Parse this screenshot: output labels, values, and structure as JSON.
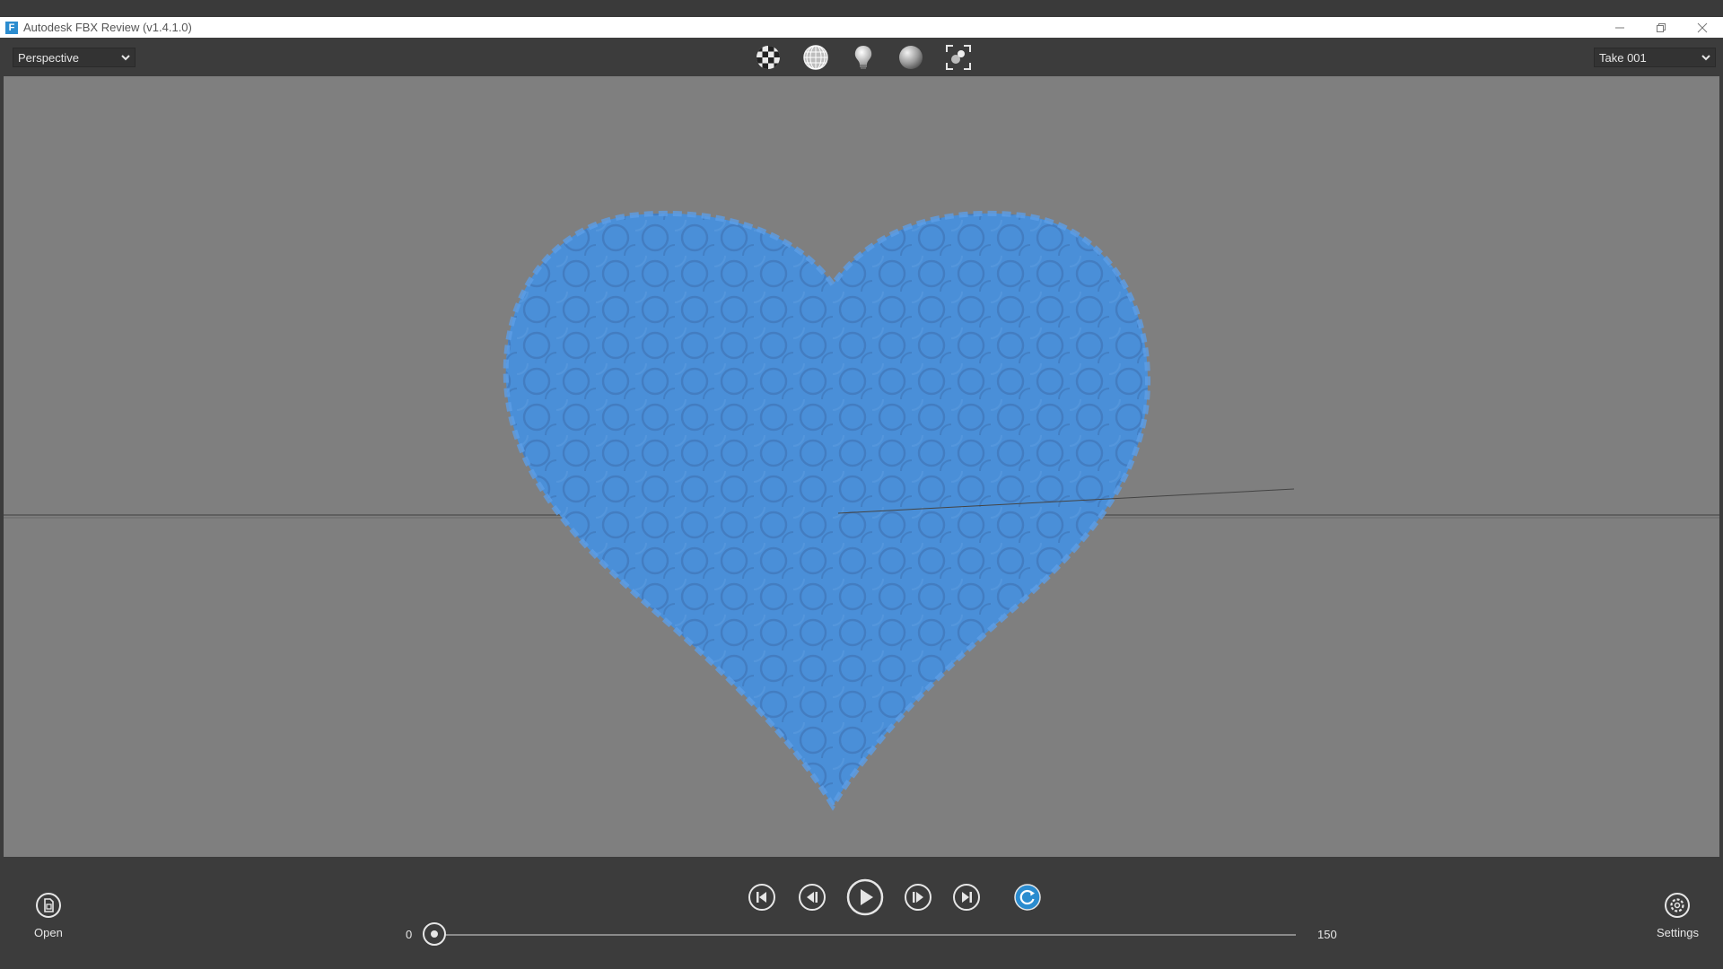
{
  "window": {
    "title": "Autodesk FBX Review (v1.4.1.0)",
    "logo_letter": "F"
  },
  "toolbar": {
    "camera_select": {
      "value": "Perspective"
    },
    "take_select": {
      "value": "Take 001"
    },
    "view_icons": [
      "checker-texture-icon",
      "wireframe-sphere-icon",
      "light-bulb-icon",
      "shaded-sphere-icon",
      "frame-all-icon"
    ]
  },
  "viewport": {
    "background": "#7f7f7f",
    "model_color": "#4a8fd8"
  },
  "bottom": {
    "open_label": "Open",
    "settings_label": "Settings",
    "timeline": {
      "start": "0",
      "end": "150",
      "current_fraction": 0.0
    },
    "transport": [
      "go-to-start-icon",
      "step-back-icon",
      "play-icon",
      "step-forward-icon",
      "go-to-end-icon",
      "loop-icon"
    ],
    "loop_color": "#2b8ccf"
  }
}
